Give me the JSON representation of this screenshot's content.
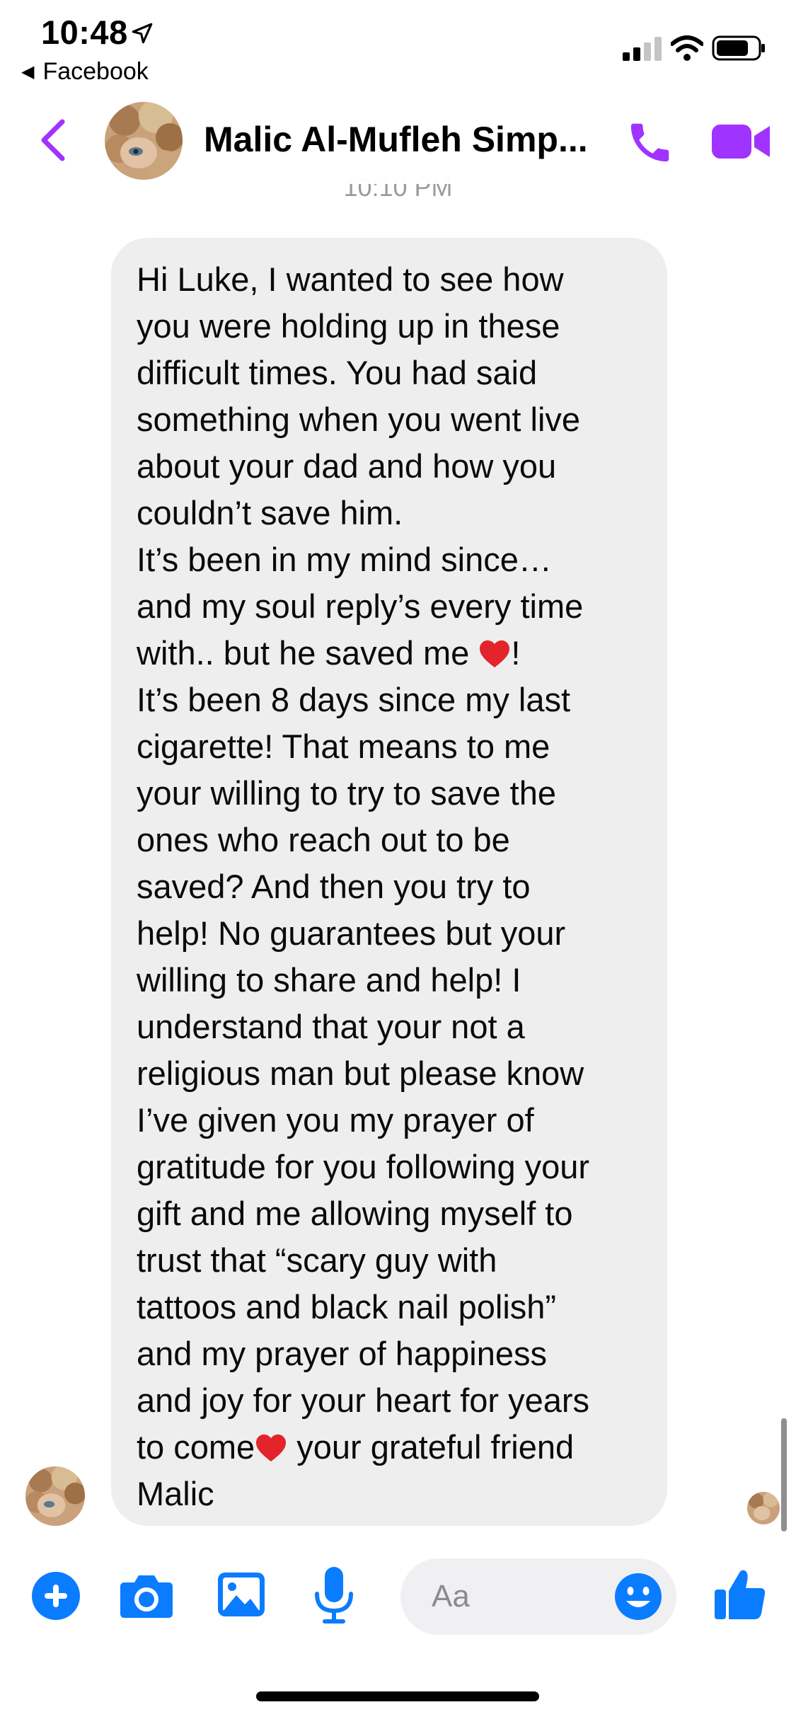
{
  "status_bar": {
    "time": "10:48",
    "back_app": "Facebook"
  },
  "header": {
    "contact_name": "Malic Al-Mufleh Simp..."
  },
  "timestamp": "10:10 PM",
  "message": {
    "lines": [
      "Hi Luke, I wanted to see how",
      "you were holding up in these",
      "difficult times. You had said",
      "something when you went live",
      "about your dad and how you",
      "couldn’t save him.",
      "It’s been in my mind since…",
      "and my soul reply’s every time",
      "with.. but he saved me",
      "It’s been 8 days since my last",
      "cigarette! That means to me",
      "your willing to try to save the",
      "ones who reach out to be",
      "saved? And then you try to",
      "help! No guarantees but your",
      "willing to share and help! I",
      "understand that your not a",
      "religious man but please know",
      "I’ve given you my prayer of",
      "gratitude for you following your",
      "gift and me allowing myself to",
      "trust that “scary guy with",
      "tattoos and black nail polish”",
      "and my prayer of happiness",
      "and joy for your heart for years",
      "to come",
      "Malic"
    ],
    "line9_after_heart": "!",
    "line26_after_heart": " your grateful friend"
  },
  "composer": {
    "placeholder": "Aa"
  },
  "colors": {
    "accent_purple": "#a033ff",
    "accent_blue": "#0a7cff",
    "bubble_bg": "#eeeeef"
  },
  "icons": [
    "location-arrow-icon",
    "signal-icon",
    "wifi-icon",
    "battery-icon",
    "back-chevron-icon",
    "phone-icon",
    "video-camera-icon",
    "plus-icon",
    "camera-icon",
    "image-icon",
    "microphone-icon",
    "emoji-icon",
    "thumbs-up-icon",
    "heart-icon"
  ]
}
